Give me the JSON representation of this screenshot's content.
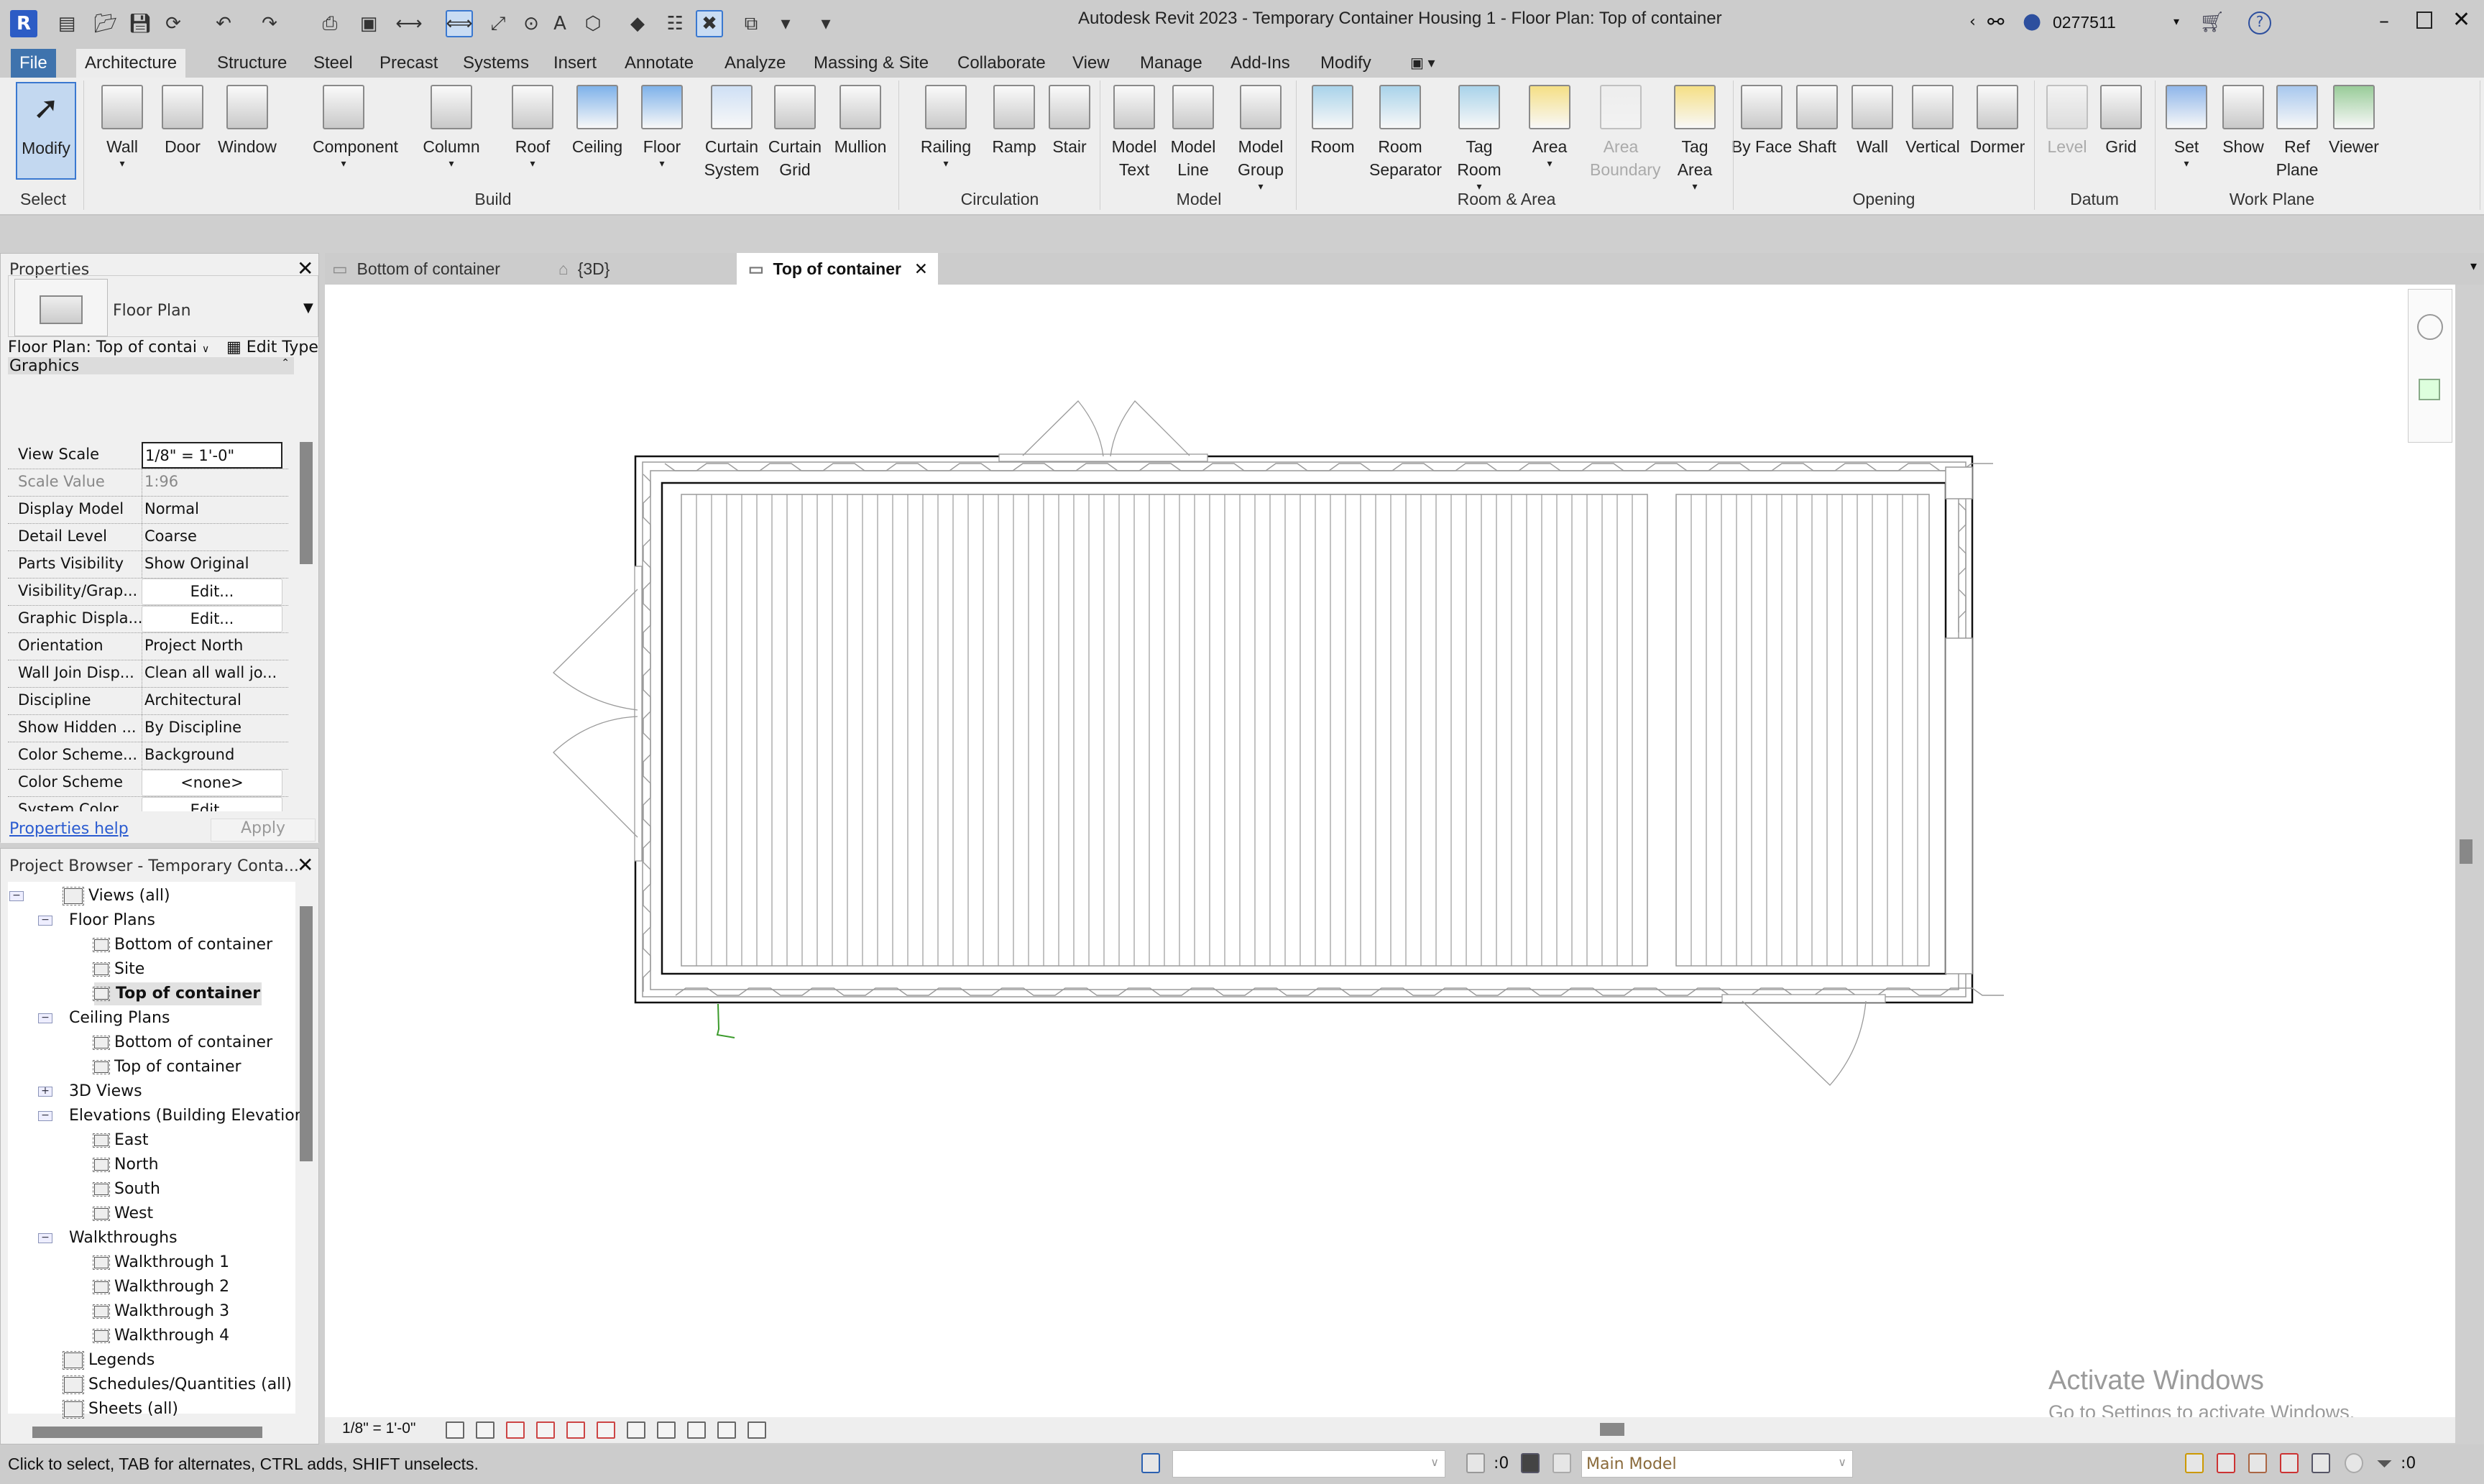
{
  "app": {
    "title": "Autodesk Revit 2023 - Temporary Container Housing 1 - Floor Plan: Top of container",
    "user": "0277511"
  },
  "quick_access": [
    "app-menu-icon",
    "properties-toggle-icon",
    "open-icon",
    "save-icon",
    "sync-icon",
    "undo-icon",
    "redo-icon",
    "print-icon",
    "export-pdf-icon",
    "aligned-dimension-icon",
    "measure-icon",
    "aligned-dim-icon",
    "tag-icon",
    "text-icon",
    "3d-view-icon",
    "section-icon",
    "thin-lines-icon",
    "close-hidden-icon",
    "switch-windows-icon",
    "customize-icon"
  ],
  "ribbon_tabs": [
    "File",
    "Architecture",
    "Structure",
    "Steel",
    "Precast",
    "Systems",
    "Insert",
    "Annotate",
    "Analyze",
    "Massing & Site",
    "Collaborate",
    "View",
    "Manage",
    "Add-Ins",
    "Modify"
  ],
  "active_tab": "Architecture",
  "ribbon_buttons": [
    {
      "label": "Modify",
      "icon": "cursor-icon"
    },
    {
      "label": "Wall",
      "icon": "wall-icon",
      "dropdown": true
    },
    {
      "label": "Door",
      "icon": "door-icon"
    },
    {
      "label": "Window",
      "icon": "window-icon"
    },
    {
      "label": "Component",
      "icon": "component-icon",
      "dropdown": true
    },
    {
      "label": "Column",
      "icon": "column-icon",
      "dropdown": true
    },
    {
      "label": "Roof",
      "icon": "roof-icon",
      "dropdown": true
    },
    {
      "label": "Ceiling",
      "icon": "ceiling-icon"
    },
    {
      "label": "Floor",
      "icon": "floor-icon",
      "dropdown": true
    },
    {
      "label": "Curtain System",
      "icon": "curtain-system-icon"
    },
    {
      "label": "Curtain Grid",
      "icon": "curtain-grid-icon"
    },
    {
      "label": "Mullion",
      "icon": "mullion-icon"
    },
    {
      "label": "Railing",
      "icon": "railing-icon",
      "dropdown": true
    },
    {
      "label": "Ramp",
      "icon": "ramp-icon"
    },
    {
      "label": "Stair",
      "icon": "stair-icon"
    },
    {
      "label": "Model Text",
      "icon": "model-text-icon"
    },
    {
      "label": "Model Line",
      "icon": "model-line-icon"
    },
    {
      "label": "Model Group",
      "icon": "model-group-icon",
      "dropdown": true
    },
    {
      "label": "Room",
      "icon": "room-icon"
    },
    {
      "label": "Room Separator",
      "icon": "room-separator-icon"
    },
    {
      "label": "Tag Room",
      "icon": "tag-room-icon",
      "dropdown": true
    },
    {
      "label": "Area",
      "icon": "area-icon",
      "dropdown": true
    },
    {
      "label": "Area Boundary",
      "icon": "area-boundary-icon",
      "disabled": true
    },
    {
      "label": "Tag Area",
      "icon": "tag-area-icon",
      "dropdown": true
    },
    {
      "label": "By Face",
      "icon": "by-face-icon"
    },
    {
      "label": "Shaft",
      "icon": "shaft-icon"
    },
    {
      "label": "Wall",
      "icon": "wall-opening-icon"
    },
    {
      "label": "Vertical",
      "icon": "vertical-opening-icon"
    },
    {
      "label": "Dormer",
      "icon": "dormer-icon"
    },
    {
      "label": "Level",
      "icon": "level-icon",
      "disabled": true
    },
    {
      "label": "Grid",
      "icon": "grid-icon"
    },
    {
      "label": "Set",
      "icon": "set-workplane-icon",
      "dropdown": true
    },
    {
      "label": "Show",
      "icon": "show-workplane-icon"
    },
    {
      "label": "Ref Plane",
      "icon": "ref-plane-icon"
    },
    {
      "label": "Viewer",
      "icon": "viewer-icon"
    }
  ],
  "ribbon_panels": [
    "Select",
    "Build",
    "Circulation",
    "Model",
    "Room & Area",
    "Opening",
    "Datum",
    "Work Plane"
  ],
  "properties": {
    "title": "Properties",
    "type_name": "Floor Plan",
    "instance_selector": "Floor Plan: Top of contai",
    "edit_type": "Edit Type",
    "group": "Graphics",
    "rows": [
      {
        "name": "View Scale",
        "value": "1/8\" = 1'-0\"",
        "kind": "input"
      },
      {
        "name": "Scale Value",
        "value": "1:96",
        "kind": "gray"
      },
      {
        "name": "Display Model",
        "value": "Normal"
      },
      {
        "name": "Detail Level",
        "value": "Coarse"
      },
      {
        "name": "Parts Visibility",
        "value": "Show Original"
      },
      {
        "name": "Visibility/Grap...",
        "value": "Edit...",
        "kind": "button"
      },
      {
        "name": "Graphic Displa...",
        "value": "Edit...",
        "kind": "button"
      },
      {
        "name": "Orientation",
        "value": "Project North"
      },
      {
        "name": "Wall Join Disp...",
        "value": "Clean all wall jo..."
      },
      {
        "name": "Discipline",
        "value": "Architectural"
      },
      {
        "name": "Show Hidden ...",
        "value": "By Discipline"
      },
      {
        "name": "Color Scheme...",
        "value": "Background"
      },
      {
        "name": "Color Scheme",
        "value": "<none>",
        "kind": "button"
      },
      {
        "name": "System Color ...",
        "value": "Edit...",
        "kind": "button"
      }
    ],
    "help_link": "Properties help",
    "apply": "Apply"
  },
  "browser": {
    "title": "Project Browser - Temporary Conta...",
    "items": [
      {
        "label": "Views (all)",
        "level": 0,
        "exp": "-"
      },
      {
        "label": "Floor Plans",
        "level": 1,
        "exp": "-"
      },
      {
        "label": "Bottom of container",
        "level": 2
      },
      {
        "label": "Site",
        "level": 2
      },
      {
        "label": "Top of container",
        "level": 2,
        "selected": true
      },
      {
        "label": "Ceiling Plans",
        "level": 1,
        "exp": "-"
      },
      {
        "label": "Bottom of container",
        "level": 2
      },
      {
        "label": "Top of container",
        "level": 2
      },
      {
        "label": "3D Views",
        "level": 1,
        "exp": "+"
      },
      {
        "label": "Elevations (Building Elevation",
        "level": 1,
        "exp": "-"
      },
      {
        "label": "East",
        "level": 2
      },
      {
        "label": "North",
        "level": 2
      },
      {
        "label": "South",
        "level": 2
      },
      {
        "label": "West",
        "level": 2
      },
      {
        "label": "Walkthroughs",
        "level": 1,
        "exp": "-"
      },
      {
        "label": "Walkthrough 1",
        "level": 2
      },
      {
        "label": "Walkthrough 2",
        "level": 2
      },
      {
        "label": "Walkthrough 3",
        "level": 2
      },
      {
        "label": "Walkthrough 4",
        "level": 2
      },
      {
        "label": "Legends",
        "level": 0
      },
      {
        "label": "Schedules/Quantities (all)",
        "level": 0
      },
      {
        "label": "Sheets (all)",
        "level": 0
      }
    ]
  },
  "view_tabs": [
    {
      "label": "Bottom of container",
      "icon": "floor-plan-icon"
    },
    {
      "label": "{3D}",
      "icon": "3d-house-icon"
    },
    {
      "label": "Top of container",
      "icon": "floor-plan-icon",
      "active": true
    }
  ],
  "view_control": {
    "scale": "1/8\" = 1'-0\""
  },
  "watermark": {
    "line1": "Activate Windows",
    "line2": "Go to Settings to activate Windows."
  },
  "status": {
    "message": "Click to select, TAB for alternates, CTRL adds, SHIFT unselects.",
    "design_option_count": ":0",
    "model": "Main Model",
    "filter_count": ":0"
  }
}
